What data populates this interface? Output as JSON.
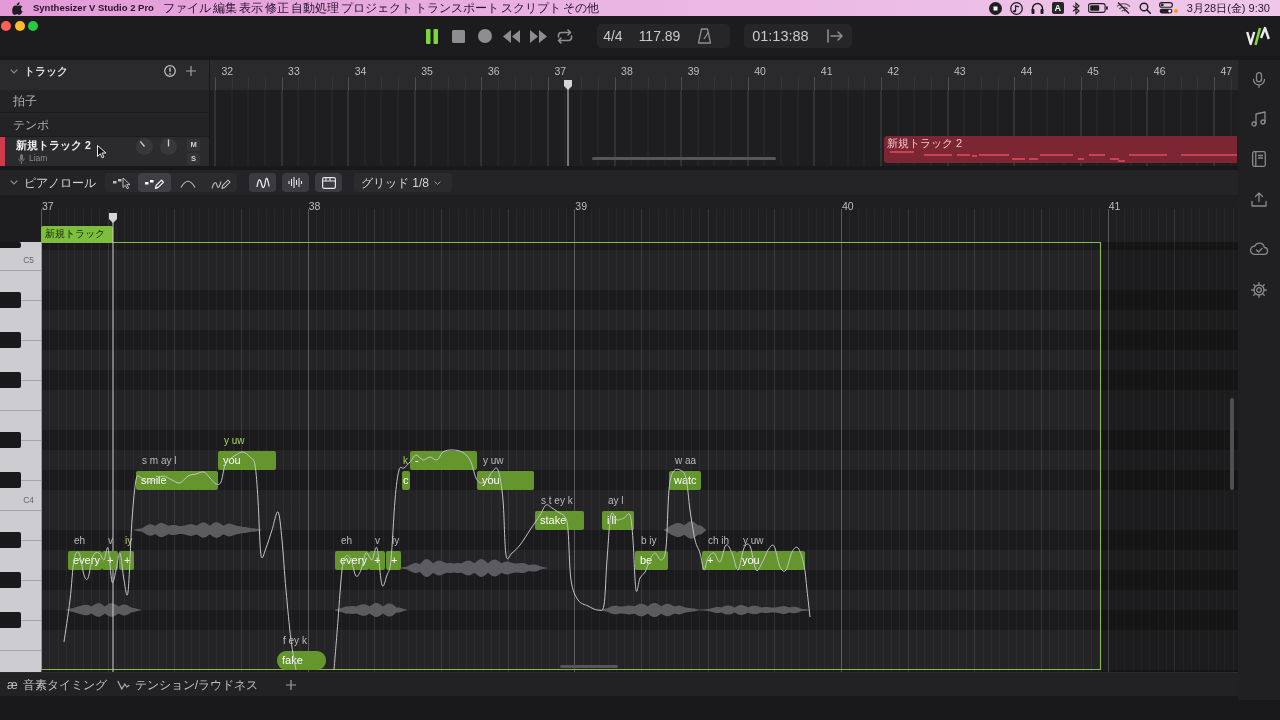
{
  "menu_bar": {
    "app_name": "Synthesizer V Studio 2 Pro",
    "menus": [
      "ファイル",
      "編集",
      "表示",
      "修正",
      "自動処理",
      "プロジェクト",
      "トランスポート",
      "スクリプト",
      "その他"
    ],
    "input_source": "A",
    "clock": "3月28日(金) 9:30"
  },
  "transport": {
    "playing": true,
    "time_signature": "4/4",
    "tempo": "117.89",
    "time": "01:13:88"
  },
  "arrangement": {
    "title": "トラック",
    "expanded": true,
    "ruler": [
      "32",
      "33",
      "34",
      "35",
      "36",
      "37",
      "38",
      "39",
      "40",
      "41",
      "42",
      "43",
      "44",
      "45",
      "46",
      "47"
    ],
    "rows": [
      "拍子",
      "テンポ"
    ],
    "tracks": [
      {
        "name": "新規トラック 2",
        "color": "#d03a4f",
        "singer": "Liam",
        "mute": "M",
        "solo": "S"
      }
    ],
    "clips": [
      {
        "name": "新規トラック 2"
      }
    ]
  },
  "piano_roll": {
    "title": "ピアノロール",
    "expanded": true,
    "tools": [
      {
        "kind": "select",
        "selected": false
      },
      {
        "kind": "note-pen",
        "selected": true
      },
      {
        "kind": "vibrato",
        "selected": false
      },
      {
        "kind": "pitch-pen",
        "selected": false
      }
    ],
    "view_toggles": [
      {
        "kind": "pitch",
        "on": true
      },
      {
        "kind": "waveform",
        "on": true
      },
      {
        "kind": "panel",
        "on": true
      }
    ],
    "grid": "グリッド 1/8",
    "ruler": [
      "37",
      "38",
      "39",
      "40",
      "41"
    ],
    "clip_label": "新規トラック",
    "key_labels": [
      "C5",
      "C4"
    ],
    "notes": [
      {
        "lyric": "every",
        "phonemes": "eh",
        "highlighted": false
      },
      {
        "lyric": "+",
        "phonemes": "v",
        "highlighted": false
      },
      {
        "lyric": "+",
        "phonemes": "iy",
        "highlighted": true
      },
      {
        "lyric": "smile",
        "phonemes": "s m ay l",
        "highlighted": false
      },
      {
        "lyric": "you",
        "phonemes": "y uw",
        "highlighted": true
      },
      {
        "lyric": "fake",
        "phonemes": "f ey k",
        "highlighted": false
      },
      {
        "lyric": "every",
        "phonemes": "eh",
        "highlighted": false
      },
      {
        "lyric": "+",
        "phonemes": "v",
        "highlighted": false
      },
      {
        "lyric": "+",
        "phonemes": "iy",
        "highlighted": false
      },
      {
        "lyric": "c",
        "phonemes": "k",
        "highlighted": true
      },
      {
        "lyric": "-"
      },
      {
        "lyric": "you",
        "phonemes": "y uw",
        "highlighted": false
      },
      {
        "lyric": "stake",
        "phonemes": "s t ey k",
        "highlighted": false
      },
      {
        "lyric": "i'll",
        "phonemes": "ay l",
        "highlighted": false
      },
      {
        "lyric": "be",
        "phonemes": "b iy",
        "highlighted": false
      },
      {
        "lyric": "watc",
        "phonemes": "w aa",
        "highlighted": false
      },
      {
        "lyric": "+",
        "phonemes": "ch ih",
        "highlighted": false
      },
      {
        "lyric": "you",
        "phonemes": "y uw",
        "highlighted": false
      }
    ]
  },
  "bottom_tabs": [
    {
      "kind": "phoneme",
      "icon": "æ",
      "label": "音素タイミング"
    },
    {
      "kind": "tension",
      "label": "テンション/ラウドネス"
    }
  ]
}
